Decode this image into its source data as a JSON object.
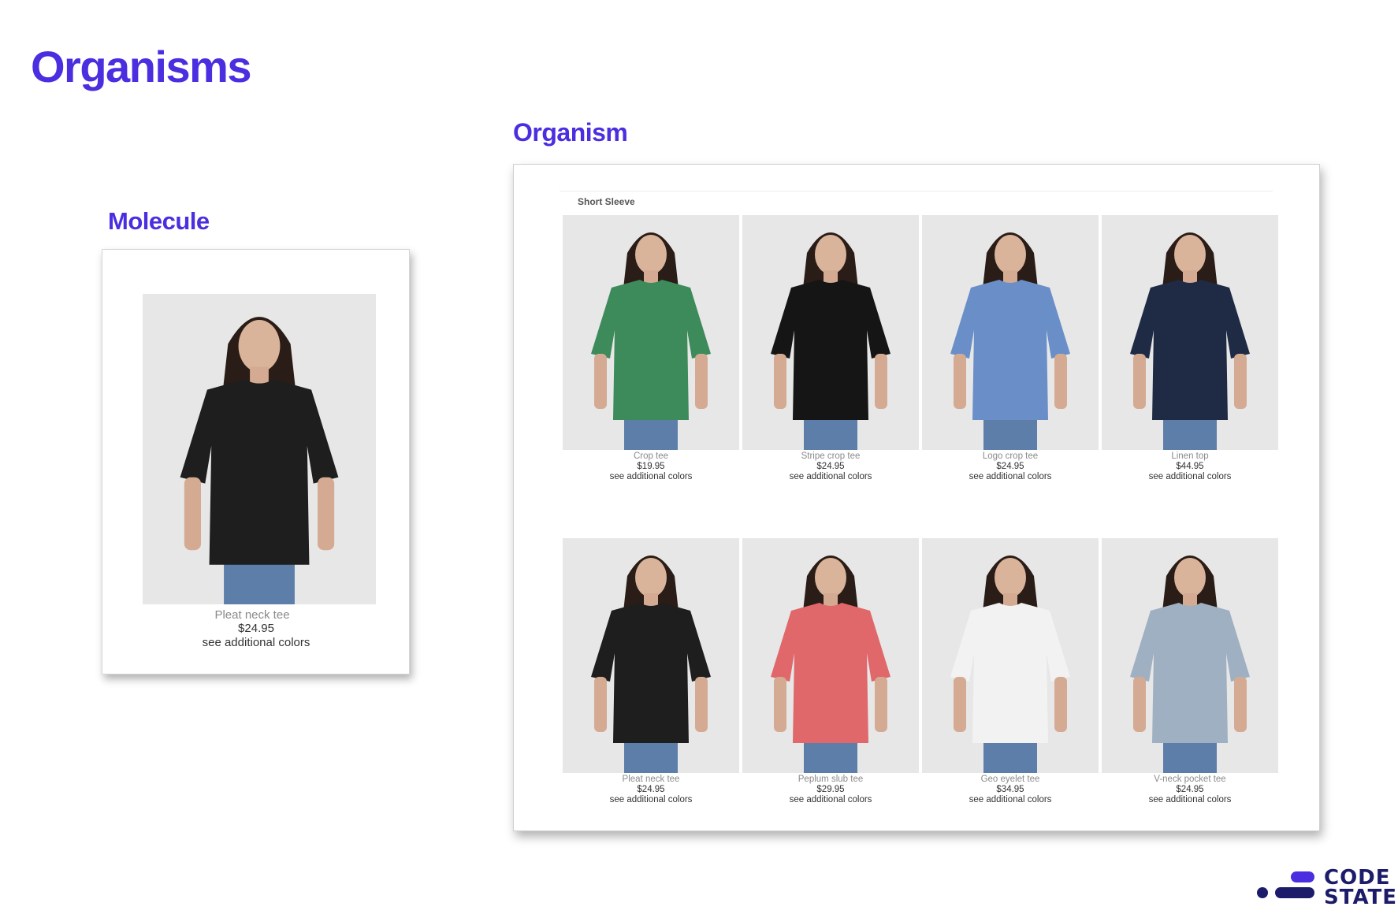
{
  "page": {
    "title": "Organisms",
    "organism_heading": "Organism",
    "molecule_heading": "Molecule"
  },
  "molecule": {
    "name": "Pleat neck tee",
    "price": "$24.95",
    "more": "see additional colors",
    "shirt_color": "#1e1e1e"
  },
  "organism": {
    "section_title": "Short Sleeve",
    "products": [
      {
        "name": "Crop tee",
        "price": "$19.95",
        "more": "see additional colors",
        "shirt_color": "#3d8a5a"
      },
      {
        "name": "Stripe crop tee",
        "price": "$24.95",
        "more": "see additional colors",
        "shirt_color": "#151515"
      },
      {
        "name": "Logo crop tee",
        "price": "$24.95",
        "more": "see additional colors",
        "shirt_color": "#6a8fc8"
      },
      {
        "name": "Linen top",
        "price": "$44.95",
        "more": "see additional colors",
        "shirt_color": "#1f2a44"
      },
      {
        "name": "Pleat neck tee",
        "price": "$24.95",
        "more": "see additional colors",
        "shirt_color": "#1e1e1e"
      },
      {
        "name": "Peplum slub tee",
        "price": "$29.95",
        "more": "see additional colors",
        "shirt_color": "#e0676a"
      },
      {
        "name": "Geo eyelet tee",
        "price": "$34.95",
        "more": "see additional colors",
        "shirt_color": "#f2f2f2"
      },
      {
        "name": "V-neck pocket tee",
        "price": "$24.95",
        "more": "see additional colors",
        "shirt_color": "#9fb0c2"
      }
    ]
  },
  "logo": {
    "line1": "CODE",
    "line2": "STATES",
    "color": "#1c1c6a",
    "accent": "#4a2ee0"
  }
}
